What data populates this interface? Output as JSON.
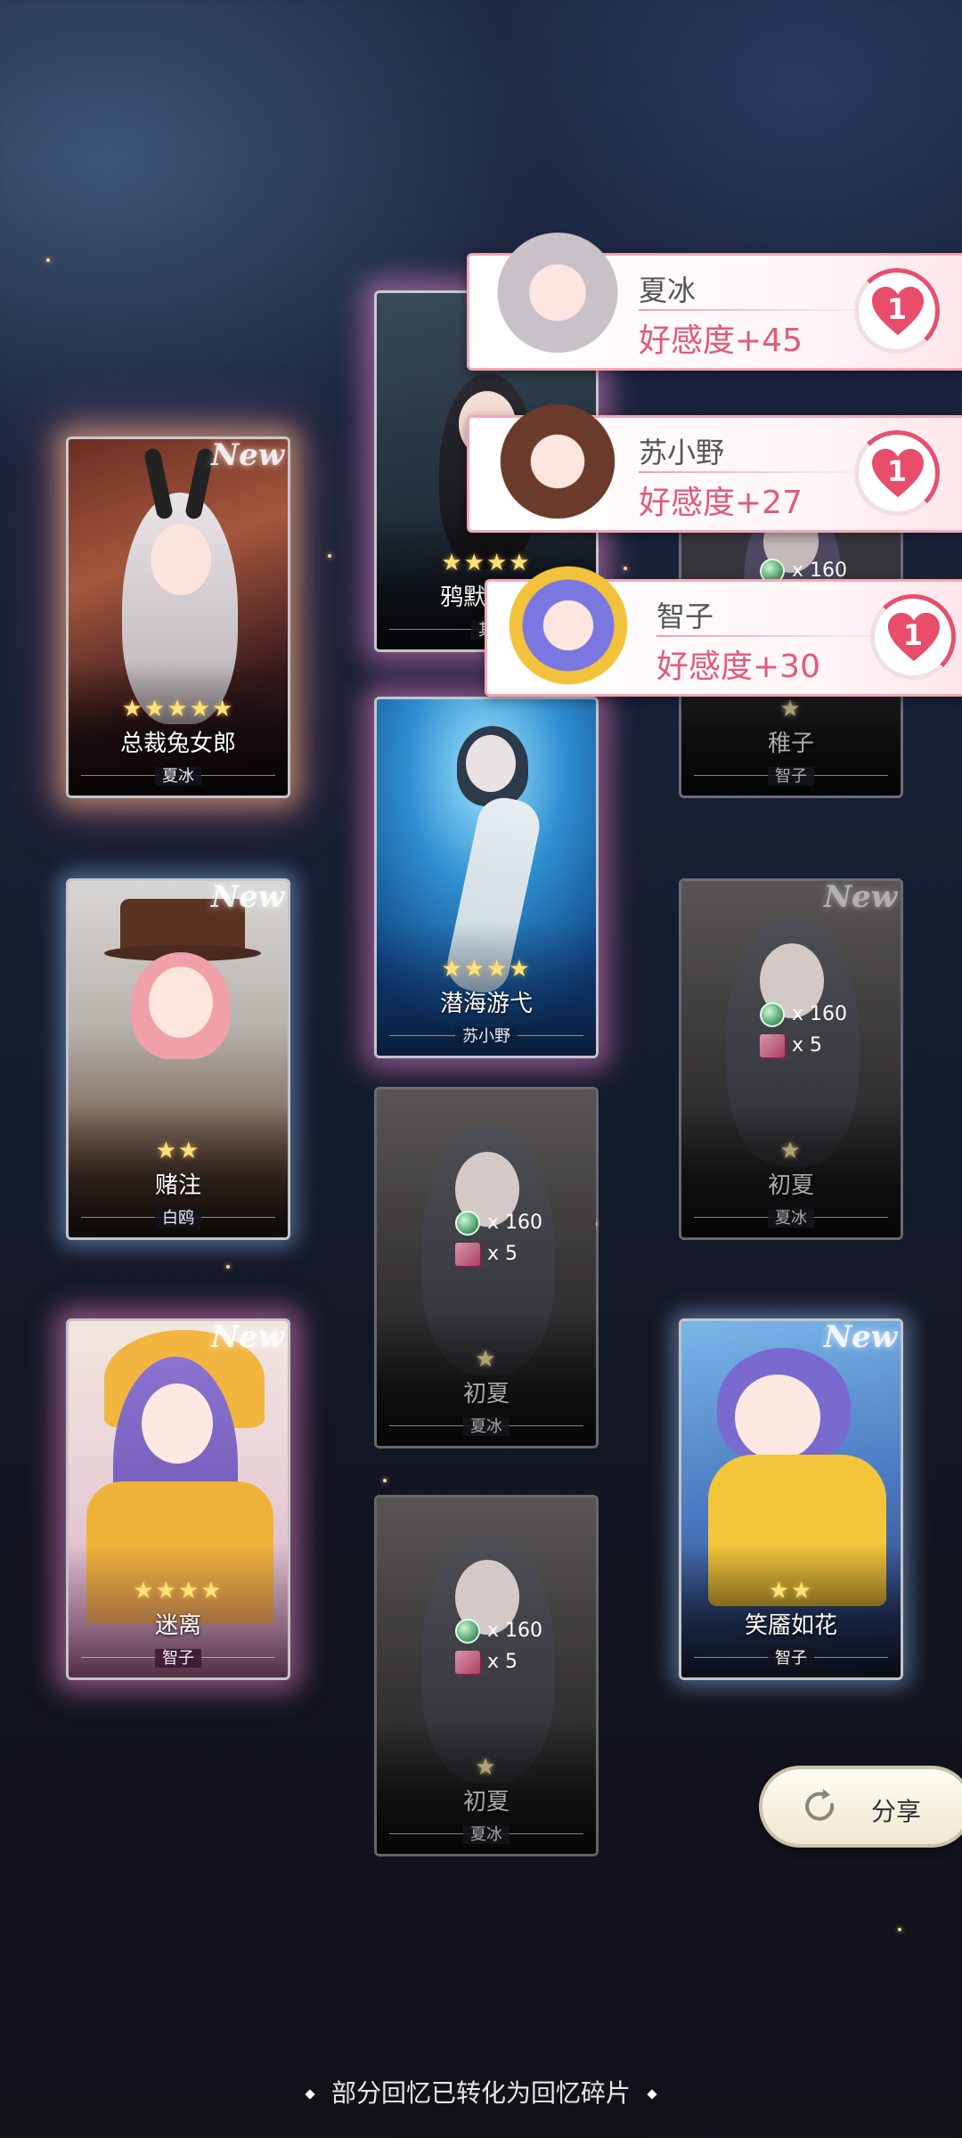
{
  "cards": [
    {
      "title": "总裁兔女郎",
      "stars": "★★★★★",
      "owner": "夏冰",
      "new": "New"
    },
    {
      "title": "鸦默雀静",
      "stars": "★★★★",
      "owner": "其"
    },
    {
      "title": "稚子",
      "stars": "★",
      "owner": "智子",
      "reward_gem": "x 160"
    },
    {
      "title": "赌注",
      "stars": "★★",
      "owner": "白鸥",
      "new": "New"
    },
    {
      "title": "潜海游弋",
      "stars": "★★★★",
      "owner": "苏小野"
    },
    {
      "title": "初夏",
      "stars": "★",
      "owner": "夏冰",
      "new": "New",
      "reward_gem": "x 160",
      "reward_cube": "x 5"
    },
    {
      "title": "初夏",
      "stars": "★",
      "owner": "夏冰",
      "reward_gem": "x 160",
      "reward_cube": "x 5"
    },
    {
      "title": "迷离",
      "stars": "★★★★",
      "owner": "智子",
      "new": "New"
    },
    {
      "title": "笑靥如花",
      "stars": "★★",
      "owner": "智子",
      "new": "New"
    },
    {
      "title": "初夏",
      "stars": "★",
      "owner": "夏冰",
      "reward_gem": "x 160",
      "reward_cube": "x 5"
    }
  ],
  "notifications": [
    {
      "name": "夏冰",
      "value": "好感度+45",
      "level": "1"
    },
    {
      "name": "苏小野",
      "value": "好感度+27",
      "level": "1"
    },
    {
      "name": "智子",
      "value": "好感度+30",
      "level": "1"
    }
  ],
  "share": {
    "label": "分享",
    "icon": "refresh-arrow-icon"
  },
  "footer": {
    "note": "部分回忆已转化为回忆碎片"
  }
}
